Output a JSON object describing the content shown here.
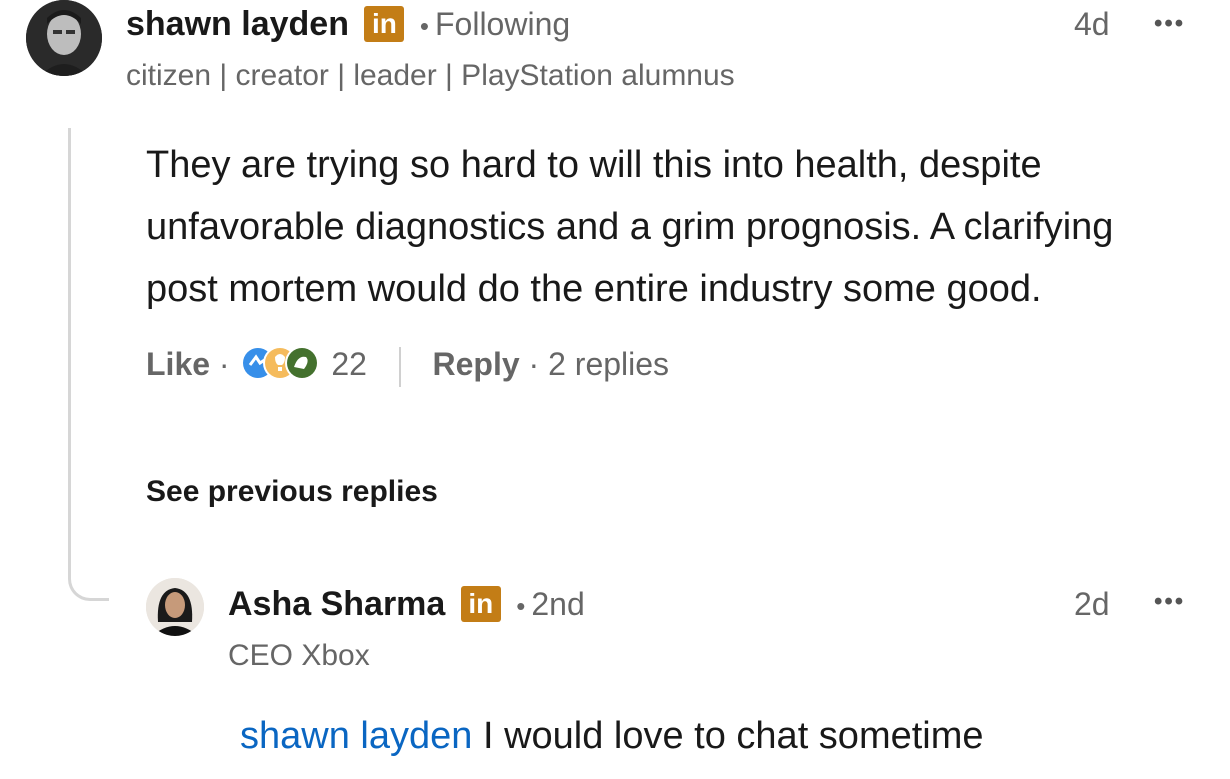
{
  "comment": {
    "author": {
      "name": "shawn layden",
      "badge": "in",
      "relation": "Following",
      "headline": "citizen | creator | leader | PlayStation alumnus"
    },
    "time": "4d",
    "more": "•••",
    "text_lines": [
      "They are trying so hard to will this into health, despite",
      "unfavorable diagnostics and a grim prognosis. A clarifying",
      "post mortem would do the entire industry some good."
    ],
    "actions": {
      "like": "Like",
      "reaction_count": "22",
      "reply": "Reply",
      "replies": "2 replies"
    }
  },
  "see_previous": "See previous replies",
  "reply": {
    "author": {
      "name": "Asha Sharma",
      "badge": "in",
      "relation": "2nd",
      "headline": "CEO Xbox"
    },
    "time": "2d",
    "more": "•••",
    "mention": "shawn layden",
    "text": " I would love to chat sometime"
  },
  "colors": {
    "badge": "#c37d16",
    "mention": "#0a66c2",
    "muted": "#666666"
  }
}
